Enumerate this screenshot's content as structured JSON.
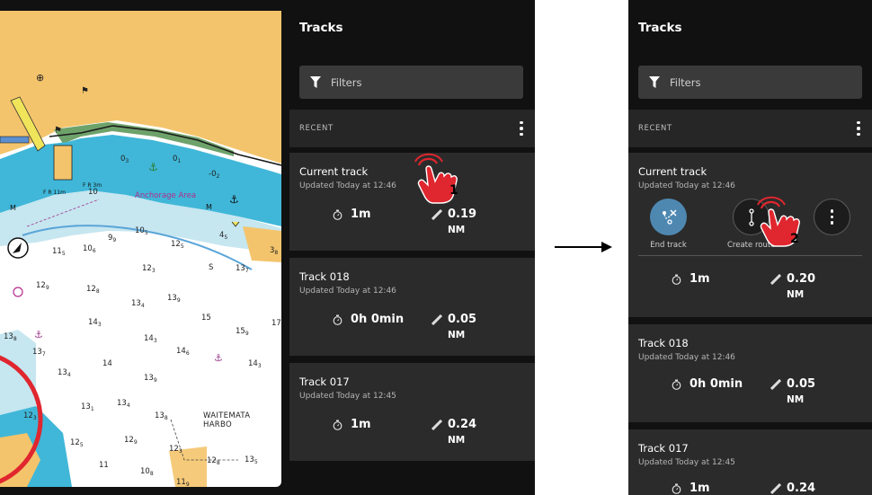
{
  "before": {
    "panel_title": "Tracks",
    "filters_label": "Filters",
    "section_label": "RECENT",
    "tracks": [
      {
        "name": "Current track",
        "updated": "Updated Today at 12:46",
        "time": "1m",
        "distance": "0.19",
        "unit": "NM"
      },
      {
        "name": "Track 018",
        "updated": "Updated Today at 12:46",
        "time": "0h 0min",
        "distance": "0.05",
        "unit": "NM"
      },
      {
        "name": "Track 017",
        "updated": "Updated Today at 12:45",
        "time": "1m",
        "distance": "0.24",
        "unit": "NM"
      }
    ],
    "step": "1"
  },
  "after": {
    "panel_title": "Tracks",
    "filters_label": "Filters",
    "section_label": "RECENT",
    "tracks": [
      {
        "name": "Current track",
        "updated": "Updated Today at 12:46",
        "time": "1m",
        "distance": "0.20",
        "unit": "NM"
      },
      {
        "name": "Track 018",
        "updated": "Updated Today at 12:46",
        "time": "0h 0min",
        "distance": "0.05",
        "unit": "NM"
      },
      {
        "name": "Track 017",
        "updated": "Updated Today at 12:45",
        "time": "1m",
        "distance": "0.24",
        "unit": ""
      }
    ],
    "actions": {
      "end_track": "End track",
      "create_route": "Create route"
    },
    "step": "2"
  },
  "map": {
    "labels": {
      "anchorage": "Anchorage Area",
      "harbour": "WAITEMATA HARBO",
      "light": "F R 11m",
      "light2": "F R 3m",
      "m1": "M",
      "m2": "M"
    },
    "soundings": [
      {
        "t": "0",
        "s": "3"
      },
      {
        "t": "0",
        "s": "1"
      },
      {
        "t": "-0",
        "s": "2"
      },
      {
        "t": "10",
        "s": ""
      },
      {
        "t": "9",
        "s": "9"
      },
      {
        "t": "10",
        "s": "5"
      },
      {
        "t": "12",
        "s": "5"
      },
      {
        "t": "4",
        "s": "5"
      },
      {
        "t": "11",
        "s": "5"
      },
      {
        "t": "10",
        "s": "6"
      },
      {
        "t": "12",
        "s": "3"
      },
      {
        "t": "S",
        "s": ""
      },
      {
        "t": "13",
        "s": "7"
      },
      {
        "t": "3",
        "s": "8"
      },
      {
        "t": "12",
        "s": "9"
      },
      {
        "t": "12",
        "s": "8"
      },
      {
        "t": "13",
        "s": "4"
      },
      {
        "t": "13",
        "s": "9"
      },
      {
        "t": "15",
        "s": ""
      },
      {
        "t": "15",
        "s": "9"
      },
      {
        "t": "17",
        "s": ""
      },
      {
        "t": "14",
        "s": "3"
      },
      {
        "t": "14",
        "s": "3"
      },
      {
        "t": "13",
        "s": "8"
      },
      {
        "t": "13",
        "s": "7"
      },
      {
        "t": "14",
        "s": "6"
      },
      {
        "t": "14",
        "s": ""
      },
      {
        "t": "14",
        "s": "3"
      },
      {
        "t": "13",
        "s": "4"
      },
      {
        "t": "13",
        "s": "9"
      },
      {
        "t": "13",
        "s": "1"
      },
      {
        "t": "13",
        "s": "4"
      },
      {
        "t": "13",
        "s": "8"
      },
      {
        "t": "12",
        "s": "3"
      },
      {
        "t": "12",
        "s": "9"
      },
      {
        "t": "12",
        "s": "5"
      },
      {
        "t": "12",
        "s": "3"
      },
      {
        "t": "11",
        "s": ""
      },
      {
        "t": "10",
        "s": "8"
      },
      {
        "t": "12",
        "s": "8"
      },
      {
        "t": "13",
        "s": "5"
      },
      {
        "t": "11",
        "s": "9"
      }
    ]
  },
  "colors": {
    "land": "#f4c46c",
    "shallow": "#40b7d8",
    "medium": "#c6e6f0",
    "deep": "#ffffff",
    "intertidal": "#6ea26b",
    "accent_blue": "#4e88b1",
    "panel": "#111111",
    "card": "#2b2b2b"
  }
}
